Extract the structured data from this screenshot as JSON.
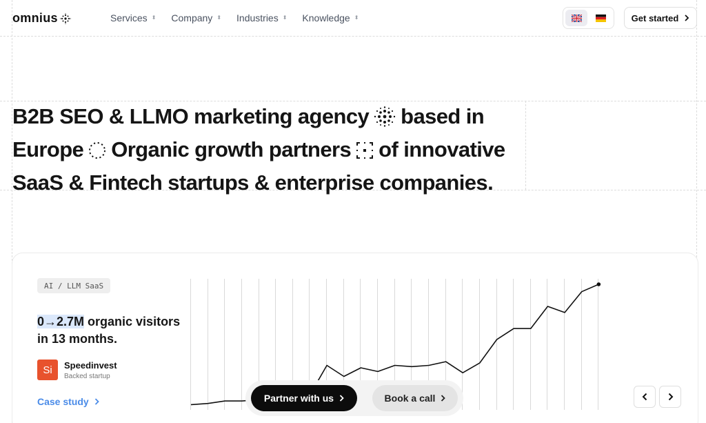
{
  "header": {
    "logo_text": "omnius",
    "nav": [
      {
        "label": "Services"
      },
      {
        "label": "Company"
      },
      {
        "label": "Industries"
      },
      {
        "label": "Knowledge"
      }
    ],
    "languages": [
      "UK flag",
      "German flag"
    ],
    "cta_label": "Get started"
  },
  "hero": {
    "part1": "B2B SEO & LLMO marketing agency",
    "part2": "based in Europe",
    "part3": "Organic growth partners",
    "part4": "of innovative SaaS & Fintech startups & enterprise companies."
  },
  "case": {
    "tag": "AI / LLM SaaS",
    "metric": "0→2.7M",
    "headline_rest": " organic visitors in 13 months.",
    "company_logo": "Si",
    "company_name": "Speedinvest",
    "company_sub": "Backed startup",
    "link_label": "Case study"
  },
  "cta": {
    "primary_label": "Partner with us",
    "secondary_label": "Book a call"
  },
  "colors": {
    "accent_blue": "#4a8be8",
    "highlight": "#dbe8fb",
    "company_logo_bg": "#e8522d",
    "primary_button": "#0c0c0c"
  },
  "chart_data": {
    "type": "line",
    "values": [
      0.02,
      0.03,
      0.05,
      0.05,
      0.06,
      0.07,
      0.07,
      0.1,
      0.34,
      0.25,
      0.32,
      0.29,
      0.34,
      0.33,
      0.34,
      0.37,
      0.28,
      0.36,
      0.55,
      0.64,
      0.64,
      0.82,
      0.77,
      0.94,
      1.0
    ]
  }
}
